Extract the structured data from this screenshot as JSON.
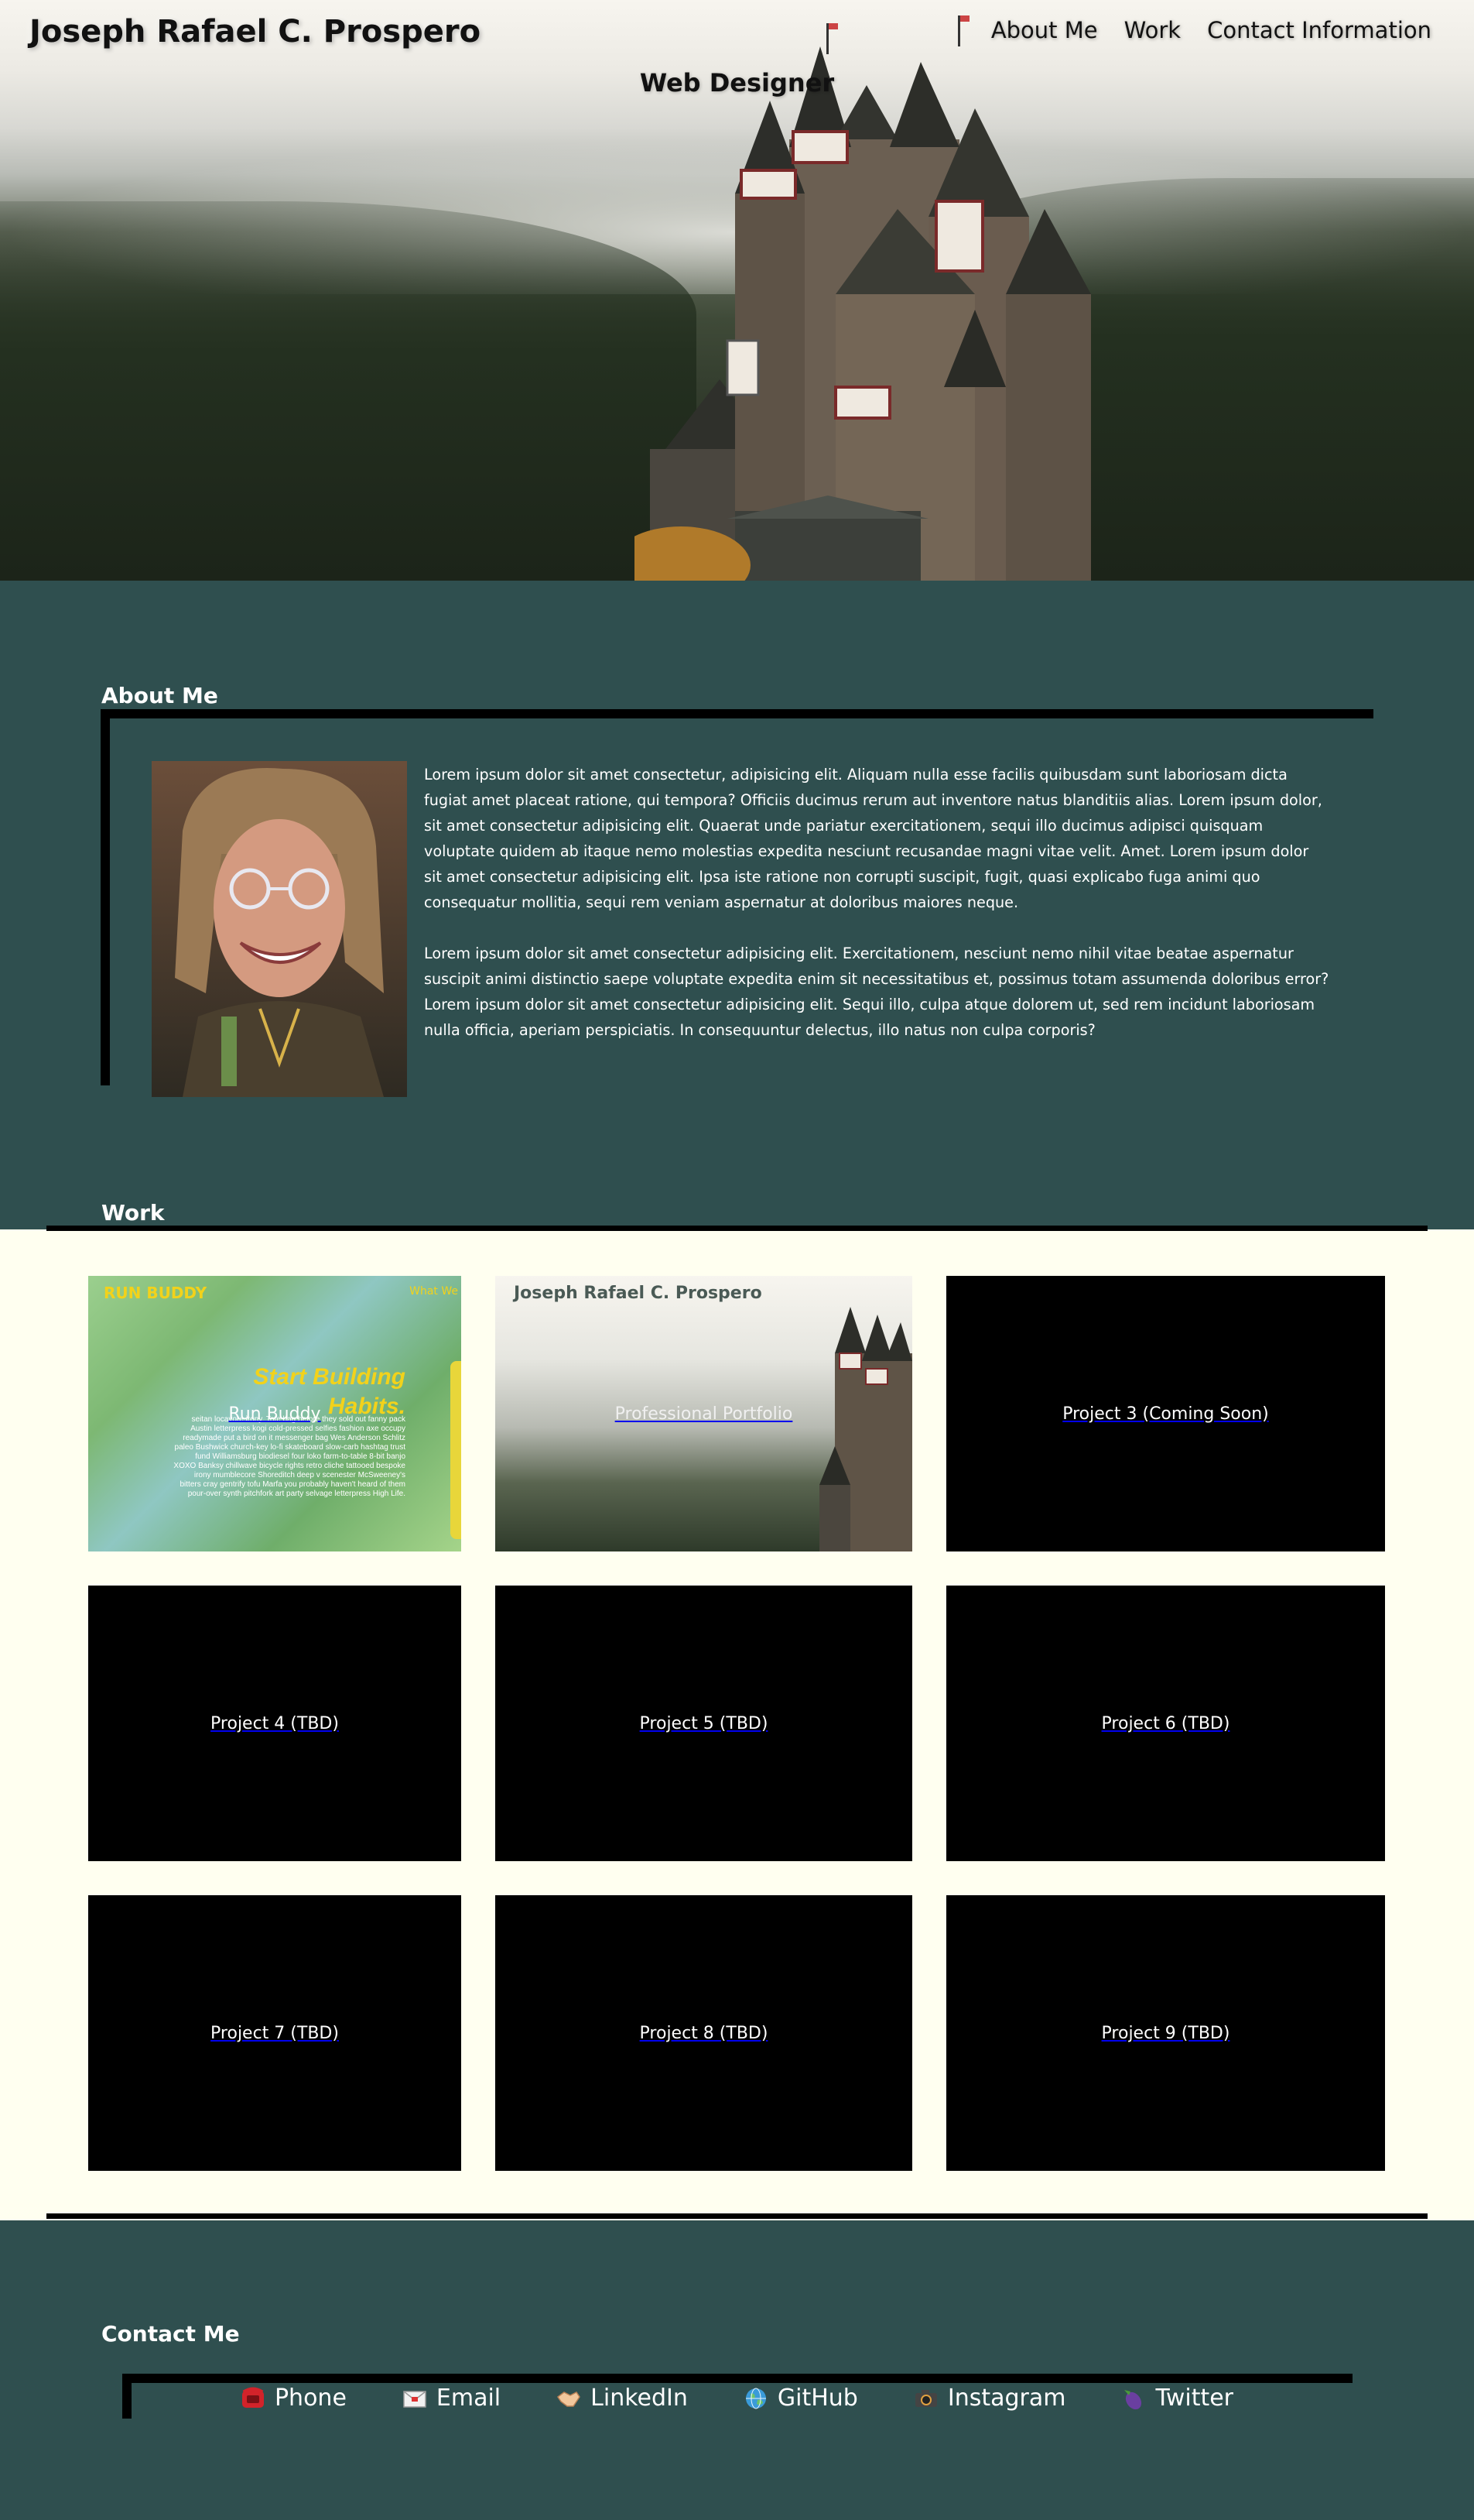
{
  "header": {
    "site_title": "Joseph Rafael C. Prospero",
    "subtitle": "Web Designer",
    "nav": [
      {
        "label": "About Me"
      },
      {
        "label": "Work"
      },
      {
        "label": "Contact Information"
      }
    ]
  },
  "about": {
    "heading": "About Me",
    "paragraphs": [
      "Lorem ipsum dolor sit amet consectetur, adipisicing elit. Aliquam nulla esse facilis quibusdam sunt laboriosam dicta fugiat amet placeat ratione, qui tempora? Officiis ducimus rerum aut inventore natus blanditiis alias. Lorem ipsum dolor, sit amet consectetur adipisicing elit. Quaerat unde pariatur exercitationem, sequi illo ducimus adipisci quisquam voluptate quidem ab itaque nemo molestias expedita nesciunt recusandae magni vitae velit. Amet. Lorem ipsum dolor sit amet consectetur adipisicing elit. Ipsa iste ratione non corrupti suscipit, fugit, quasi explicabo fuga animi quo consequatur mollitia, sequi rem veniam aspernatur at doloribus maiores neque.",
      "Lorem ipsum dolor sit amet consectetur adipisicing elit. Exercitationem, nesciunt nemo nihil vitae beatae aspernatur suscipit animi distinctio saepe voluptate expedita enim sit necessitatibus et, possimus totam assumenda doloribus error? Lorem ipsum dolor sit amet consectetur adipisicing elit. Sequi illo, culpa atque dolorem ut, sed rem incidunt laboriosam nulla officia, aperiam perspiciatis. In consequuntur delectus, illo natus non culpa corporis?"
    ]
  },
  "work": {
    "heading": "Work",
    "run_buddy": {
      "label": "Run Buddy",
      "brand": "RUN BUDDY",
      "nav_hint": "What We",
      "headline_1": "Start Building",
      "headline_2": "Habits.",
      "blurb": "seitan locavore irony. Tote bag before they sold out fanny pack Austin letterpress kogi cold-pressed selfies fashion axe occupy readymade put a bird on it messenger bag Wes Anderson Schlitz paleo Bushwick church-key lo-fi skateboard slow-carb hashtag trust fund Williamsburg biodiesel four loko farm-to-table 8-bit banjo XOXO Banksy chillwave bicycle rights retro cliche tattooed bespoke irony mumblecore Shoreditch deep v scenester McSweeney's bitters cray gentrify tofu Marfa you probably haven't heard of them pour-over synth pitchfork art party selvage letterpress High Life."
    },
    "portfolio": {
      "label": "Professional Portfolio",
      "name": "Joseph Rafael C. Prospero"
    },
    "projects": [
      {
        "label": "Project 3 (Coming Soon)"
      },
      {
        "label": "Project 4 (TBD)"
      },
      {
        "label": "Project 5 (TBD)"
      },
      {
        "label": "Project 6 (TBD)"
      },
      {
        "label": "Project 7 (TBD)"
      },
      {
        "label": "Project 8 (TBD)"
      },
      {
        "label": "Project 9 (TBD)"
      }
    ]
  },
  "contact": {
    "heading": "Contact Me",
    "items": [
      {
        "label": "Phone",
        "icon": "telephone-icon"
      },
      {
        "label": "Email",
        "icon": "envelope-icon"
      },
      {
        "label": "LinkedIn",
        "icon": "handshake-icon"
      },
      {
        "label": "GitHub",
        "icon": "globe-icon"
      },
      {
        "label": "Instagram",
        "icon": "camera-icon"
      },
      {
        "label": "Twitter",
        "icon": "eggplant-icon"
      }
    ]
  },
  "colors": {
    "section_bg": "#2f4f4f",
    "work_bg": "#fffff0",
    "tile_bg": "#000000",
    "accent_yellow": "#f2d21b"
  }
}
